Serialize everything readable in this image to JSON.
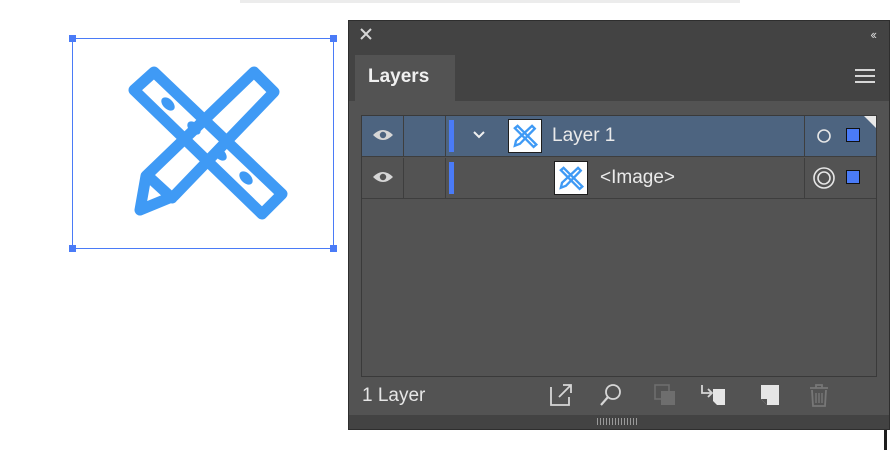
{
  "panel": {
    "tab_label": "Layers",
    "layer_count": "1 Layer",
    "collapse_label": "‹‹"
  },
  "layers": [
    {
      "name": "Layer 1",
      "visible": true,
      "expanded": true,
      "selected": true,
      "color": "#4a7bf7"
    },
    {
      "name": "<Image>",
      "visible": true,
      "selected": false,
      "color": "#4a7bf7"
    }
  ],
  "footer_icons": [
    "export-icon",
    "search-icon",
    "clipping-mask-icon",
    "move-selection-icon",
    "new-layer-icon",
    "trash-icon"
  ],
  "colors": {
    "accent": "#4a7bf7",
    "artwork": "#3f9af5",
    "panel_bg": "#535353",
    "panel_header": "#434343",
    "row_selected": "#4d6480"
  }
}
